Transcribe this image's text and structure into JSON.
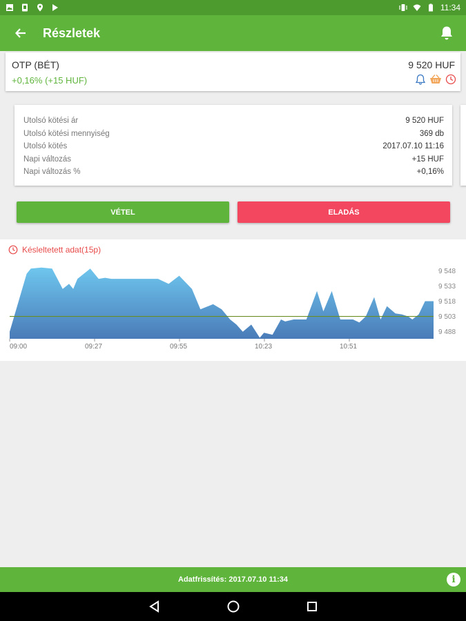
{
  "status_bar": {
    "time": "11:34"
  },
  "header": {
    "title": "Részletek"
  },
  "stock": {
    "name": "OTP (BÉT)",
    "price": "9 520 HUF",
    "change": "+0,16% (+15 HUF)"
  },
  "details": [
    {
      "label": "Utolsó kötési ár",
      "value": "9 520 HUF"
    },
    {
      "label": "Utolsó kötési mennyiség",
      "value": "369 db"
    },
    {
      "label": "Utolsó kötés",
      "value": "2017.07.10 11:16"
    },
    {
      "label": "Napi változás",
      "value": "+15 HUF"
    },
    {
      "label": "Napi változás %",
      "value": "+0,16%"
    }
  ],
  "buttons": {
    "buy": "VÉTEL",
    "sell": "ELADÁS"
  },
  "delay_notice": "Késleltetett adat(15p)",
  "colors": {
    "green": "#5fb43c",
    "dark_green": "#4d9a2e",
    "red": "#f2475f",
    "area_top": "#6ec6ee",
    "area_bottom": "#4a7bb8",
    "reference_line": "#6b8e23"
  },
  "chart_data": {
    "type": "area",
    "x_ticks": [
      "09:00",
      "09:27",
      "09:55",
      "10:23",
      "10:51"
    ],
    "y_ticks": [
      "9 548",
      "9 533",
      "9 518",
      "9 503",
      "9 488"
    ],
    "ylim": [
      9481,
      9557
    ],
    "reference_value": 9503,
    "x": [
      0,
      8,
      10,
      15,
      20,
      25,
      28,
      30,
      32,
      35,
      38,
      42,
      45,
      48,
      52,
      55,
      60,
      70,
      75,
      80,
      86,
      90,
      96,
      100,
      104,
      107,
      110,
      114,
      118,
      120,
      124,
      128,
      130,
      134,
      138,
      140,
      145,
      148,
      152,
      156,
      160,
      162,
      165,
      168,
      172,
      175,
      178,
      182,
      185,
      188,
      190,
      193,
      196,
      198,
      200
    ],
    "values": [
      9488,
      9545,
      9550,
      9551,
      9550,
      9530,
      9535,
      9530,
      9540,
      9545,
      9550,
      9540,
      9541,
      9540,
      9540,
      9540,
      9540,
      9540,
      9535,
      9543,
      9530,
      9510,
      9515,
      9510,
      9500,
      9495,
      9488,
      9495,
      9482,
      9487,
      9485,
      9500,
      9498,
      9500,
      9500,
      9500,
      9528,
      9508,
      9528,
      9500,
      9500,
      9500,
      9497,
      9503,
      9522,
      9500,
      9513,
      9506,
      9505,
      9503,
      9500,
      9505,
      9518,
      9518,
      9518
    ]
  },
  "footer": {
    "label": "Adatfrissítés:",
    "value": "2017.07.10 11:34"
  }
}
